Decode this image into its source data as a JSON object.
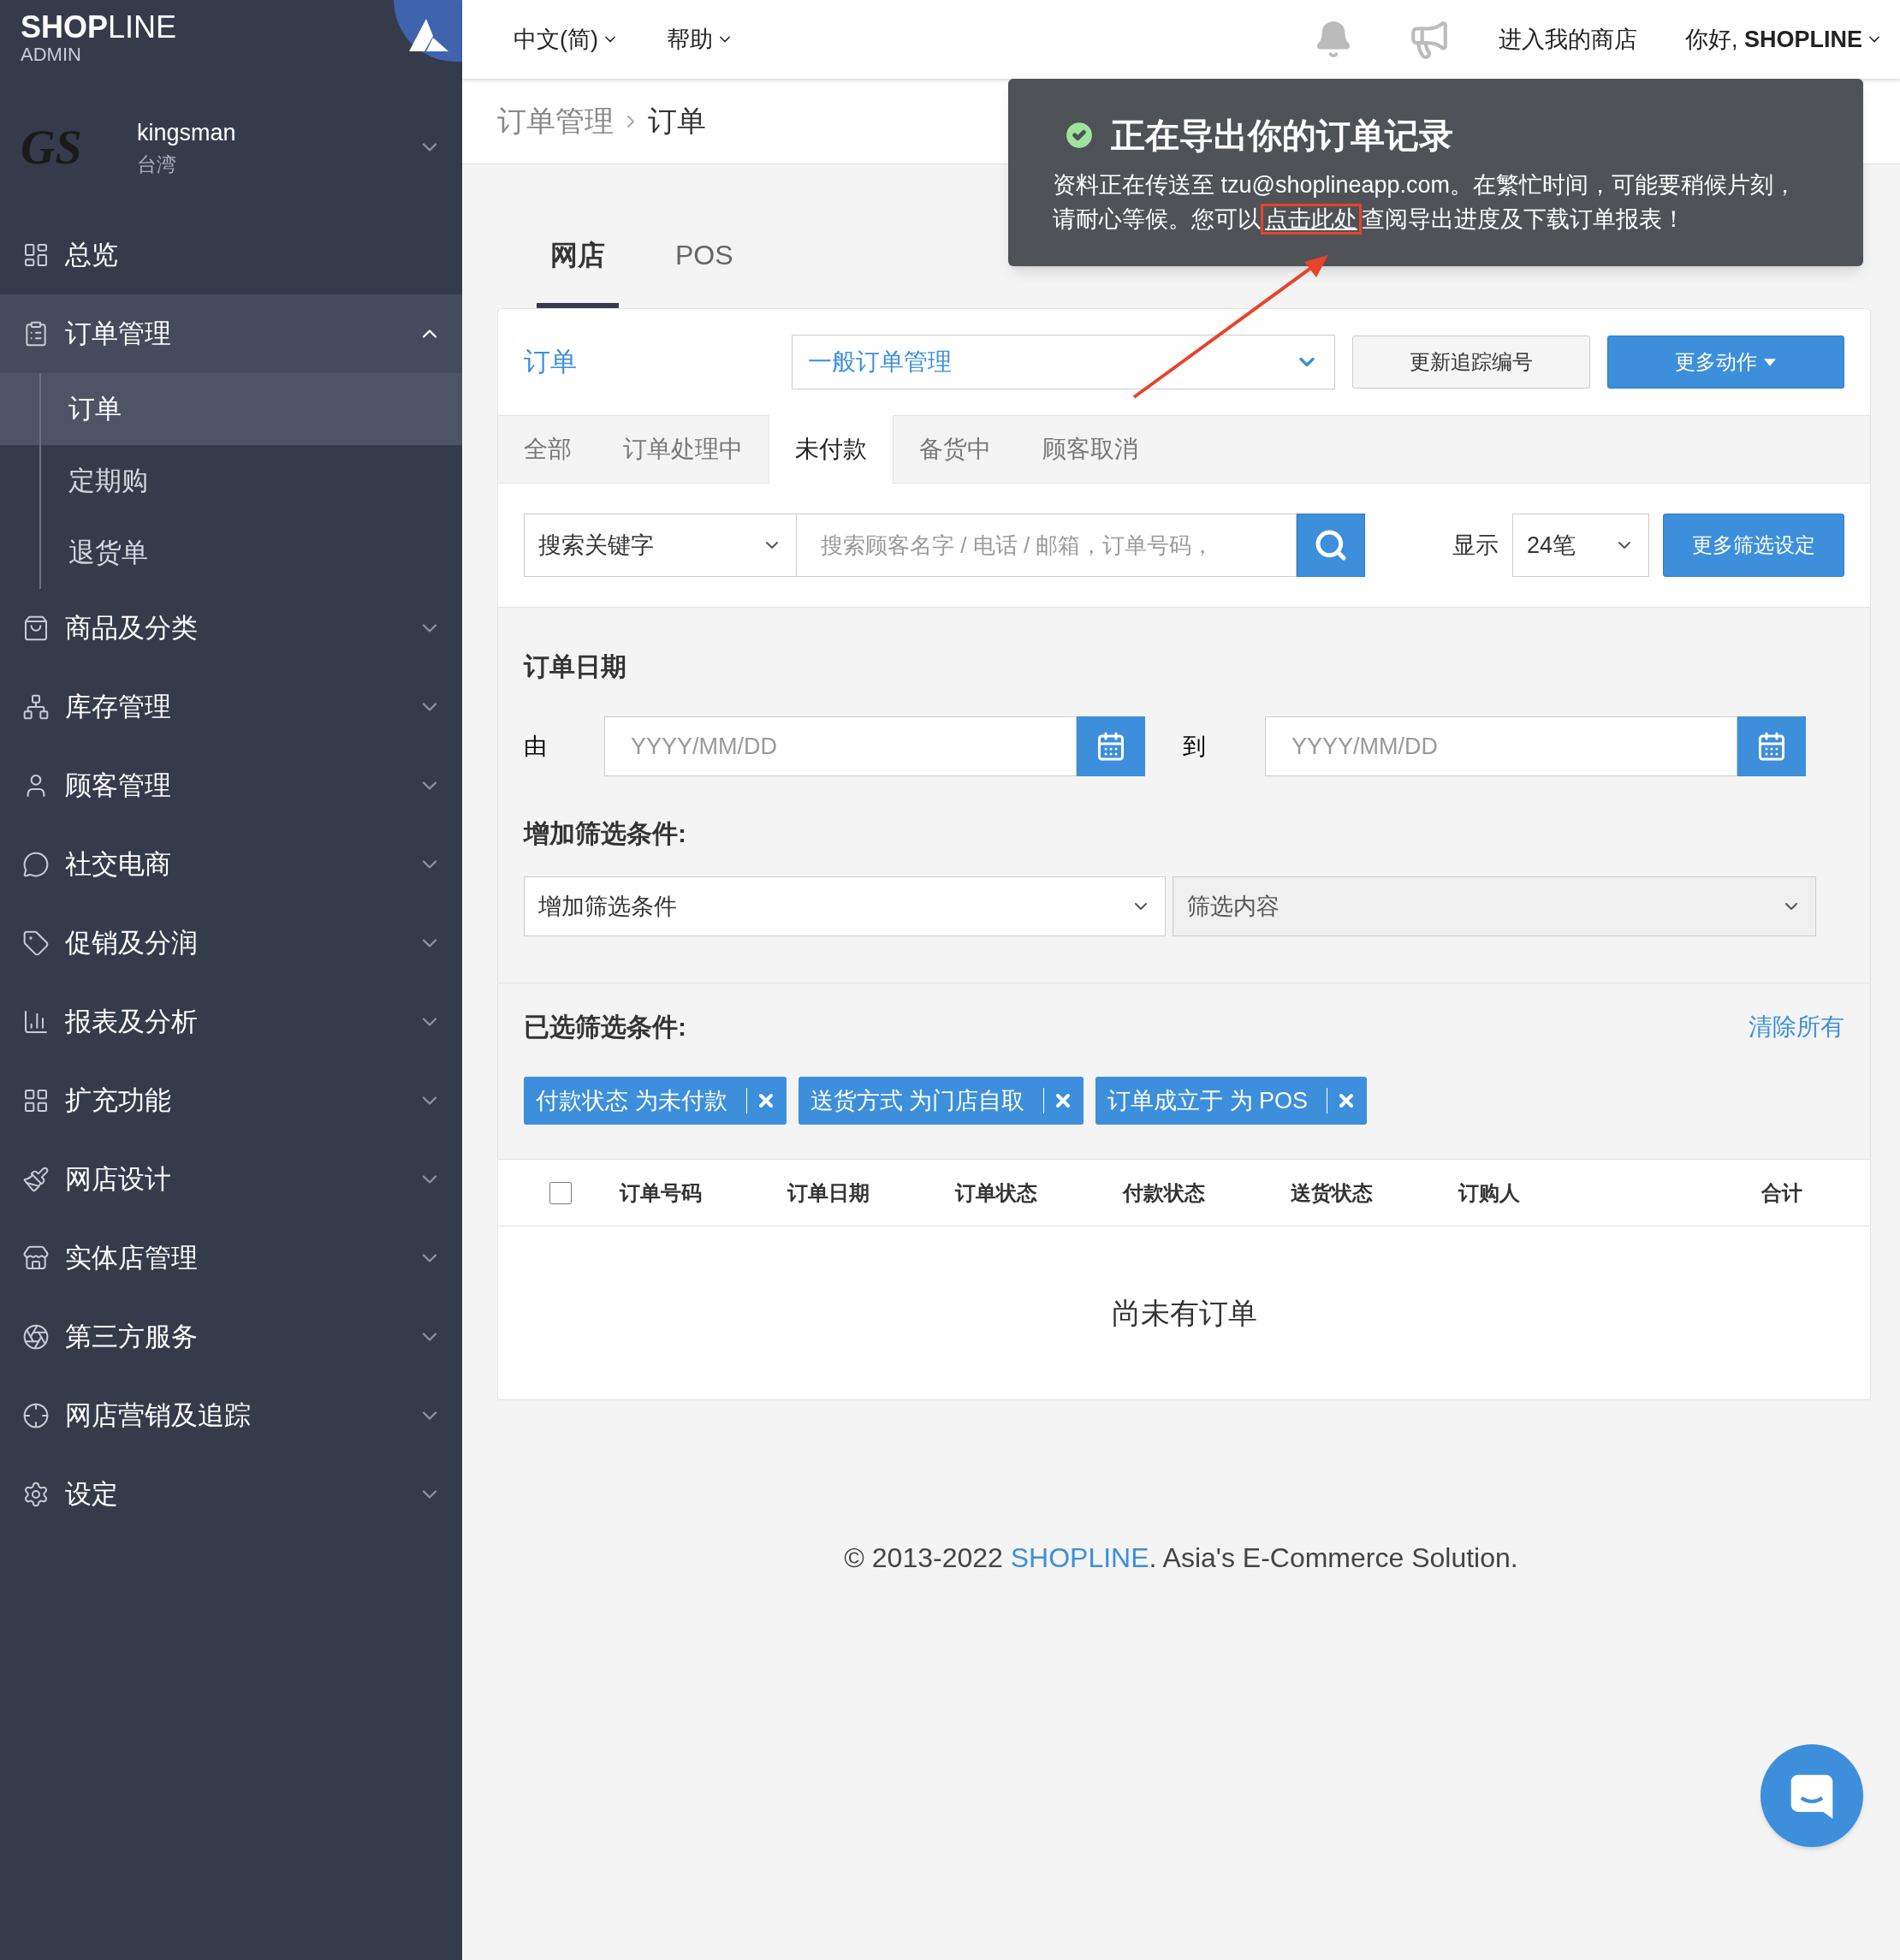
{
  "sidebar": {
    "logo": {
      "bold": "SHOP",
      "light": "LINE",
      "sub": "ADMIN"
    },
    "store": {
      "logo_text": "GS",
      "name": "kingsman",
      "region": "台湾"
    },
    "items": [
      {
        "label": "总览",
        "kind": "link"
      },
      {
        "label": "订单管理",
        "kind": "group",
        "expanded": true,
        "children": [
          {
            "label": "订单",
            "selected": true
          },
          {
            "label": "定期购",
            "selected": false
          },
          {
            "label": "退货单",
            "selected": false
          }
        ]
      },
      {
        "label": "商品及分类",
        "kind": "group",
        "expanded": false
      },
      {
        "label": "库存管理",
        "kind": "group",
        "expanded": false
      },
      {
        "label": "顾客管理",
        "kind": "group",
        "expanded": false
      },
      {
        "label": "社交电商",
        "kind": "group",
        "expanded": false
      },
      {
        "label": "促销及分润",
        "kind": "group",
        "expanded": false
      },
      {
        "label": "报表及分析",
        "kind": "group",
        "expanded": false
      },
      {
        "label": "扩充功能",
        "kind": "group",
        "expanded": false
      },
      {
        "label": "网店设计",
        "kind": "group",
        "expanded": false
      },
      {
        "label": "实体店管理",
        "kind": "group",
        "expanded": false
      },
      {
        "label": "第三方服务",
        "kind": "group",
        "expanded": false
      },
      {
        "label": "网店营销及追踪",
        "kind": "group",
        "expanded": false
      },
      {
        "label": "设定",
        "kind": "group",
        "expanded": false
      }
    ]
  },
  "topbar": {
    "language": "中文(简)",
    "help": "帮助",
    "store_link": "进入我的商店",
    "greeting": "你好, **SHOPLINE**"
  },
  "breadcrumb": [
    "订单管理",
    "订单"
  ],
  "channel_tabs": [
    {
      "label": "网店",
      "selected": true
    },
    {
      "label": "POS",
      "selected": false
    }
  ],
  "orders": {
    "title": "订单",
    "view_select": "一般订单管理",
    "buttons": [
      {
        "label": "更新追踪编号",
        "kind": "default"
      },
      {
        "label": "更多动作",
        "kind": "primary"
      }
    ],
    "status_tabs": [
      {
        "label": "全部",
        "selected": false
      },
      {
        "label": "订单处理中",
        "selected": false
      },
      {
        "label": "未付款",
        "selected": true
      },
      {
        "label": "备货中",
        "selected": false
      },
      {
        "label": "顾客取消",
        "selected": false
      }
    ],
    "search": {
      "field": "搜索关键字",
      "placeholder": "搜索顾客名字 / 电话 / 邮箱，订单号码，",
      "display_label": "显示",
      "per_page": "24笔",
      "more_filters": "更多筛选设定"
    },
    "date": {
      "title": "订单日期",
      "from_label": "由",
      "from_placeholder": "YYYY/MM/DD",
      "to_label": "到",
      "to_placeholder": "YYYY/MM/DD"
    },
    "add_filter": {
      "title": "增加筛选条件:",
      "condition": "增加筛选条件",
      "content": "筛选内容",
      "content_disabled": true
    },
    "selected_filters": {
      "title": "已选筛选条件:",
      "clear": "清除所有",
      "tags": [
        "付款状态 为未付款",
        "送货方式 为门店自取",
        "订单成立于 为 POS"
      ]
    },
    "table": {
      "select_all_checked": false,
      "columns": [
        "订单号码",
        "订单日期",
        "订单状态",
        "付款状态",
        "送货状态",
        "订购人",
        "合计"
      ],
      "empty": "尚未有订单"
    }
  },
  "footer": {
    "before": "© 2013-2022 ",
    "link": "SHOPLINE",
    "after": ". Asia's E-Commerce Solution."
  },
  "toast": {
    "title": "正在导出你的订单记录",
    "before": "资料正在传送至 tzu@shoplineapp.com。在繁忙时间，可能要稍候片刻，请耐心等候。您可以",
    "link": "点击此处",
    "after": "查阅导出进度及下载订单报表！"
  }
}
